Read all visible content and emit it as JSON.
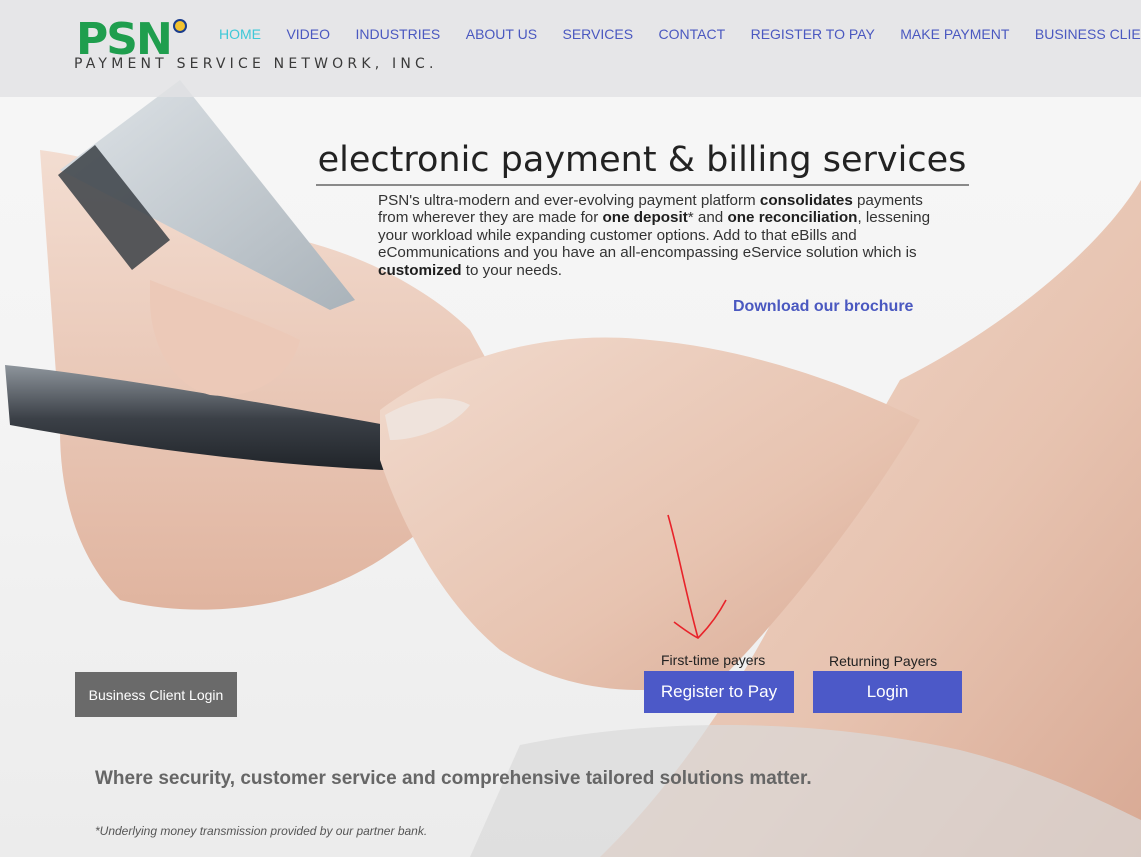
{
  "logo": {
    "mark": "PSN",
    "subtitle": "PAYMENT SERVICE NETWORK, INC."
  },
  "nav": {
    "items": [
      {
        "label": "HOME",
        "active": true
      },
      {
        "label": "VIDEO",
        "active": false
      },
      {
        "label": "INDUSTRIES",
        "active": false
      },
      {
        "label": "ABOUT US",
        "active": false
      },
      {
        "label": "SERVICES",
        "active": false
      },
      {
        "label": "CONTACT",
        "active": false
      },
      {
        "label": "REGISTER TO PAY",
        "active": false
      },
      {
        "label": "MAKE PAYMENT",
        "active": false
      },
      {
        "label": "BUSINESS CLIENTS",
        "active": false
      }
    ]
  },
  "hero": {
    "title": "electronic payment & billing services",
    "intro": {
      "t1": "PSN's ultra-modern and ever-evolving payment platform ",
      "b1": "consolidates",
      "t2": " payments from wherever they are made for ",
      "b2": "one deposit",
      "t3": "* and ",
      "b3": "one reconciliation",
      "t4": ", lessening your workload while expanding customer options. Add to that eBills and eCommunications and you have an all-encompassing eService solution which is ",
      "b4": "customized",
      "t5": " to your needs."
    },
    "brochure_link": "Download our brochure"
  },
  "cta": {
    "first_time_caption": "First-time payers",
    "register_button": "Register to Pay",
    "returning_caption": "Returning Payers",
    "login_button": "Login",
    "business_login_button": "Business Client Login"
  },
  "tagline": "Where security, customer service and comprehensive tailored solutions matter.",
  "footnote": "*Underlying money transmission provided by our partner bank.",
  "colors": {
    "accent_blue": "#4c59c8",
    "nav_active": "#3ec8d8",
    "logo_green": "#1f9e4e",
    "annotation_red": "#e8232a"
  },
  "icons": {
    "annotation": "red-hand-drawn-arrow"
  }
}
